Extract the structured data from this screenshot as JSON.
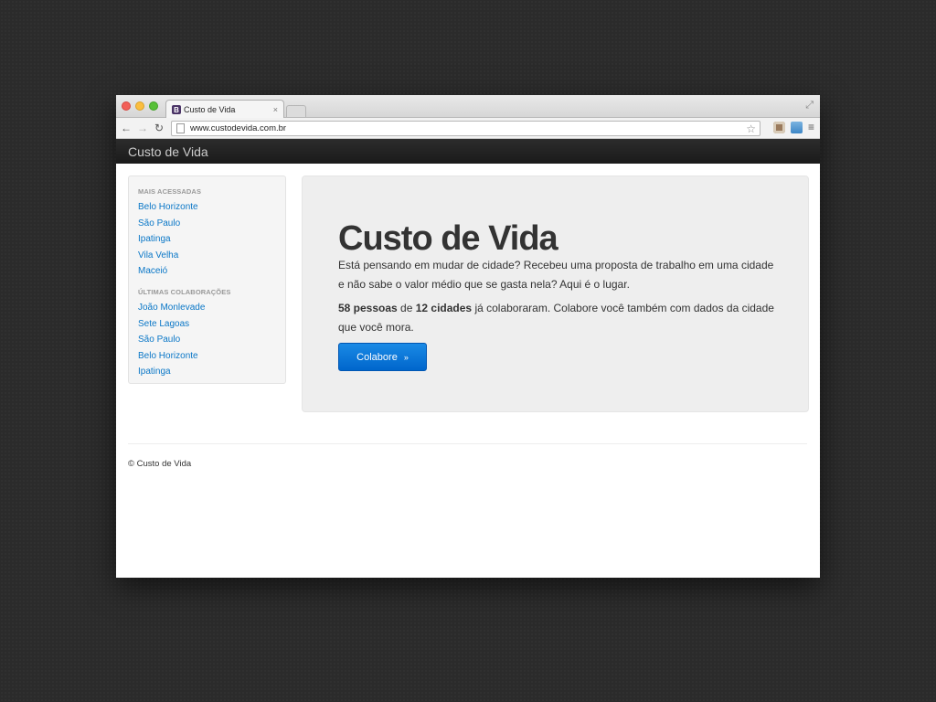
{
  "browser": {
    "tab_title": "Custo de Vida",
    "tab_favicon_letter": "B",
    "tab_close": "×",
    "url": "www.custodevida.com.br",
    "back_icon": "←",
    "forward_icon": "→",
    "reload_icon": "↻",
    "star_icon": "☆",
    "menu_icon": "≡",
    "fullscreen_icon": "⤢"
  },
  "navbar": {
    "brand": "Custo de Vida"
  },
  "sidebar": {
    "section1_header": "MAIS ACESSADAS",
    "section1_items": [
      "Belo Horizonte",
      "São Paulo",
      "Ipatinga",
      "Vila Velha",
      "Maceió"
    ],
    "section2_header": "ÚLTIMAS COLABORAÇÕES",
    "section2_items": [
      "João Monlevade",
      "Sete Lagoas",
      "São Paulo",
      "Belo Horizonte",
      "Ipatinga"
    ]
  },
  "hero": {
    "title": "Custo de Vida",
    "paragraph1": "Está pensando em mudar de cidade? Recebeu uma proposta de trabalho em uma cidade e não sabe o valor médio que se gasta nela? Aqui é o lugar.",
    "people_count": "58 pessoas",
    "connector": " de ",
    "city_count": "12 cidades",
    "paragraph2_rest": " já colaboraram. Colabore você também com dados da cidade que você mora.",
    "button_label": "Colabore",
    "button_arrow": "»"
  },
  "footer": {
    "text": "© Custo de Vida"
  }
}
